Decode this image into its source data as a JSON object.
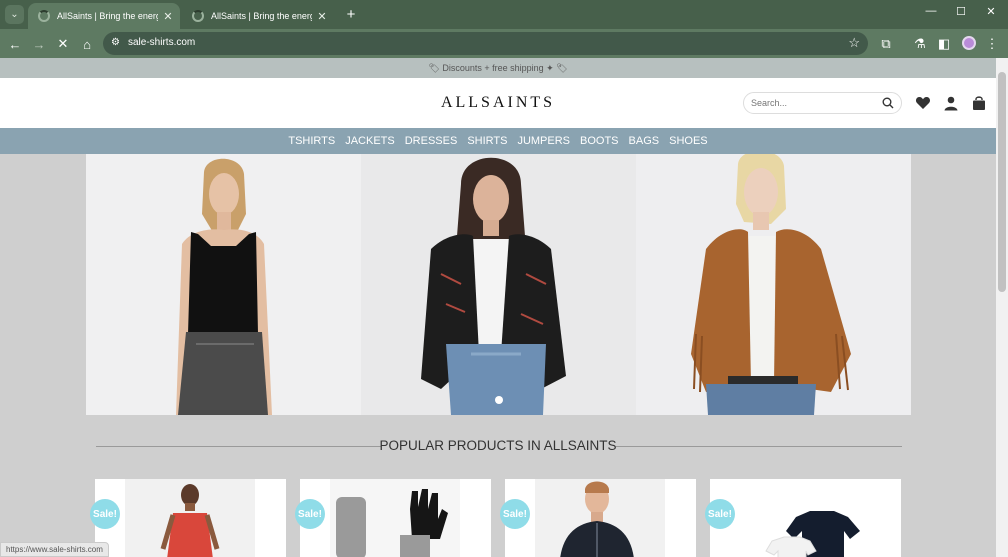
{
  "browser": {
    "tabs": [
      {
        "title": "AllSaints | Bring the energy to",
        "active": true
      },
      {
        "title": "AllSaints | Bring the energy to",
        "active": false
      }
    ],
    "url": "sale-shirts.com",
    "status_url": "https://www.sale-shirts.com"
  },
  "site": {
    "announcement": "🏷 Discounts + free shipping ✦ 🏷",
    "logo": "ALLSAINTS",
    "search_placeholder": "Search...",
    "nav": [
      "TSHIRTS",
      "JACKETS",
      "DRESSES",
      "SHIRTS",
      "JUMPERS",
      "BOOTS",
      "BAGS",
      "SHOES"
    ],
    "section_title": "POPULAR PRODUCTS IN ALLSAINTS",
    "products": [
      {
        "badge": "Sale!",
        "image": "red-dress"
      },
      {
        "badge": "Sale!",
        "image": "gloves-and-scarf"
      },
      {
        "badge": "Sale!",
        "image": "man-black-jumper"
      },
      {
        "badge": "Sale!",
        "image": "tshirts"
      }
    ],
    "colors": {
      "nav": "#8aa3b1",
      "announcement": "#b7c0bf",
      "sale_badge": "#8fdce8",
      "chrome": "#47604b"
    }
  }
}
